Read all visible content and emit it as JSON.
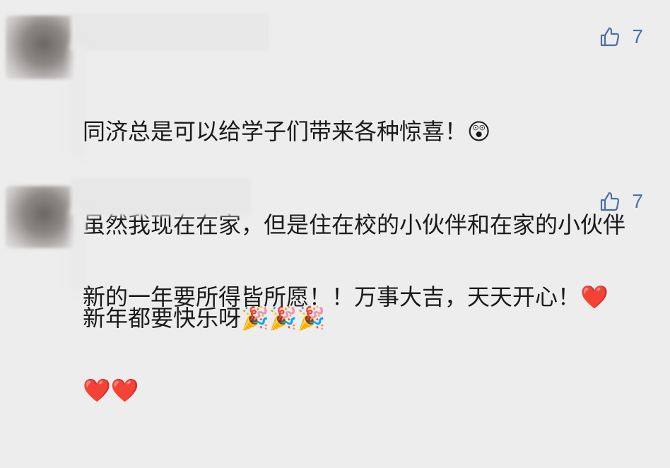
{
  "comments": [
    {
      "likes": "7",
      "lines": [
        "同济总是可以给学子们带来各种惊喜！😲",
        "虽然我现在在家，但是住在校的小伙伴和在家的小伙伴",
        "新年都要快乐呀🎉🎉🎉"
      ]
    },
    {
      "likes": "7",
      "lines": [
        "新的一年要所得皆所愿！！万事大吉，天天开心！❤️",
        "❤️❤️"
      ]
    }
  ],
  "icons": {
    "like": "thumbs-up-icon",
    "avatar": "blurred-avatar"
  },
  "colors": {
    "background": "#ededed",
    "like": "#4a6fa8",
    "text": "#1a1a1a"
  }
}
